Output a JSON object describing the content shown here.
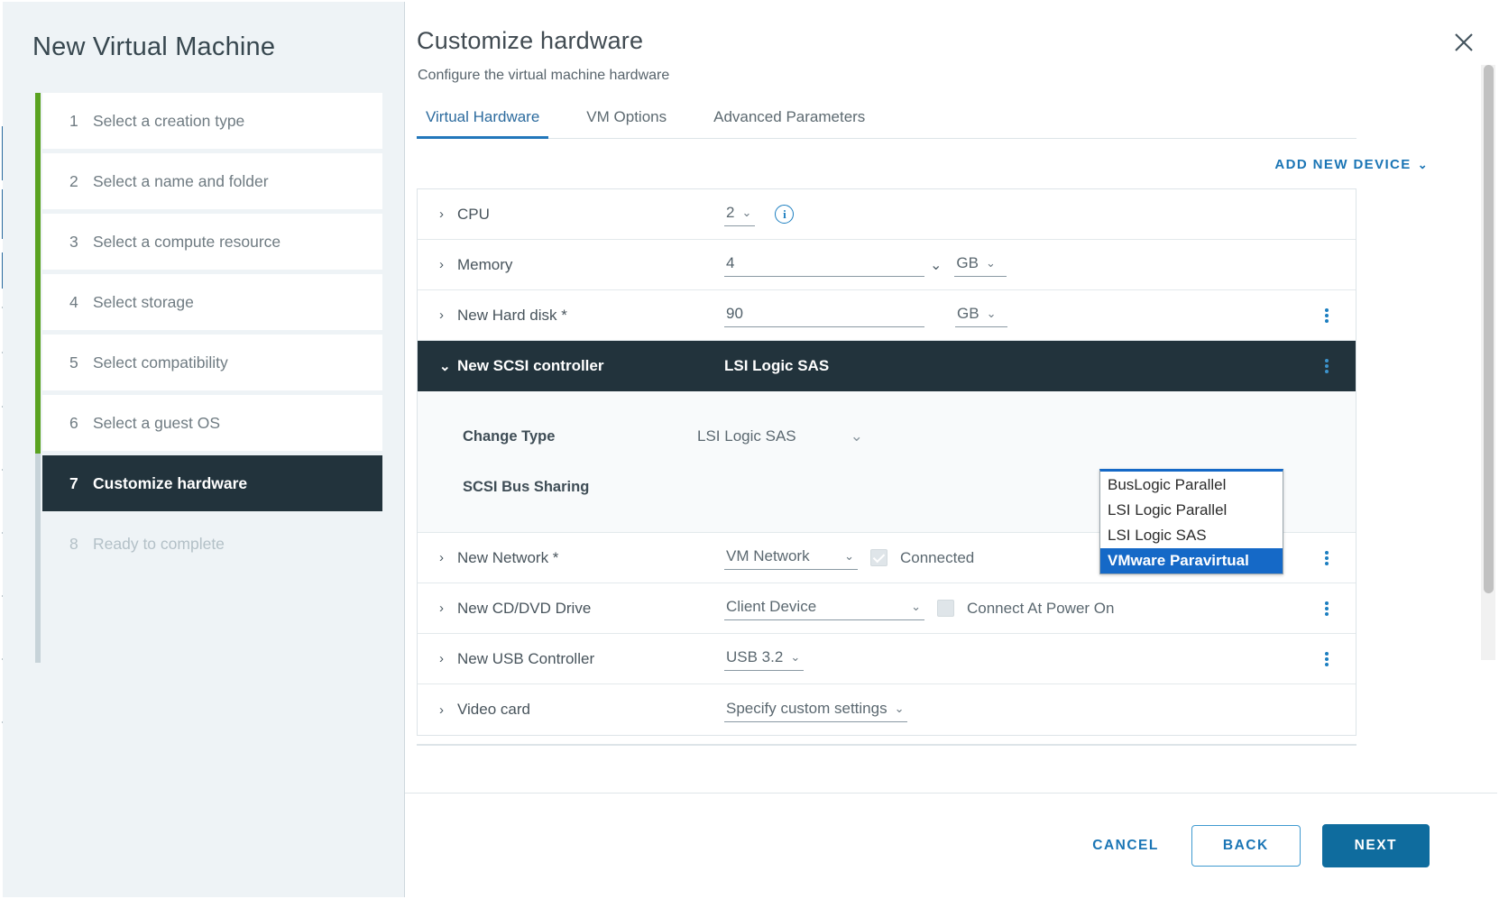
{
  "window": {
    "outer_border_color": "#9aa6ad"
  },
  "sidebar": {
    "title": "New Virtual Machine",
    "accent_done_color": "#5aa220",
    "accent_pending_color": "#c7d3d9",
    "current_bg": "#22333c",
    "steps": [
      {
        "num": "1",
        "label": "Select a creation type",
        "state": "done"
      },
      {
        "num": "2",
        "label": "Select a name and folder",
        "state": "done"
      },
      {
        "num": "3",
        "label": "Select a compute resource",
        "state": "done"
      },
      {
        "num": "4",
        "label": "Select storage",
        "state": "done"
      },
      {
        "num": "5",
        "label": "Select compatibility",
        "state": "done"
      },
      {
        "num": "6",
        "label": "Select a guest OS",
        "state": "done"
      },
      {
        "num": "7",
        "label": "Customize hardware",
        "state": "current"
      },
      {
        "num": "8",
        "label": "Ready to complete",
        "state": "disabled"
      }
    ]
  },
  "panel": {
    "title": "Customize hardware",
    "subtitle": "Configure the virtual machine hardware",
    "close_icon": "close-icon",
    "tabs": [
      {
        "label": "Virtual Hardware",
        "active": true
      },
      {
        "label": "VM Options",
        "active": false
      },
      {
        "label": "Advanced Parameters",
        "active": false
      }
    ],
    "active_tab_color": "#2277bb",
    "add_new_device": {
      "label": "ADD NEW DEVICE",
      "chevron": "⌄",
      "color": "#1a75b5"
    }
  },
  "hardware": {
    "rows": [
      {
        "label": "CPU",
        "caret": "›",
        "value": "2",
        "control": "select-number",
        "info_icon": "info-icon",
        "kebab": false
      },
      {
        "label": "Memory",
        "caret": "›",
        "value": "4",
        "control": "input-wide",
        "unit": "GB",
        "kebab": false
      },
      {
        "label": "New Hard disk *",
        "caret": "›",
        "value": "90",
        "control": "input-wide",
        "unit": "GB",
        "kebab": true
      }
    ],
    "scsi": {
      "label": "New SCSI controller",
      "caret": "⌄",
      "value": "LSI Logic SAS",
      "expanded": true,
      "kebab": true,
      "sub_rows": [
        {
          "label": "Change Type",
          "value": "LSI Logic SAS"
        },
        {
          "label": "SCSI Bus Sharing",
          "value": ""
        }
      ]
    },
    "dropdown": {
      "open": true,
      "accent_color": "#1569c7",
      "options": [
        {
          "label": "BusLogic Parallel",
          "selected": false
        },
        {
          "label": "LSI Logic Parallel",
          "selected": false
        },
        {
          "label": "LSI Logic SAS",
          "selected": false
        },
        {
          "label": "VMware Paravirtual",
          "selected": true
        }
      ]
    },
    "rows_after": [
      {
        "label": "New Network *",
        "caret": "›",
        "value": "VM Network",
        "control": "select-plain-underline",
        "checkbox": {
          "label": "Connected",
          "checked": true
        },
        "kebab": true
      },
      {
        "label": "New CD/DVD Drive",
        "caret": "›",
        "value": "Client Device",
        "control": "select-wide",
        "checkbox": {
          "label": "Connect At Power On",
          "checked": false
        },
        "kebab": true
      },
      {
        "label": "New USB Controller",
        "caret": "›",
        "value": "USB 3.2",
        "control": "select-plain-underline",
        "kebab": true
      },
      {
        "label": "Video card",
        "caret": "›",
        "value": "Specify custom settings",
        "control": "select-plain-underline",
        "kebab": false
      }
    ]
  },
  "footer": {
    "cancel": "CANCEL",
    "back": "BACK",
    "next": "NEXT",
    "primary_color": "#0f6c9e"
  },
  "scrollbar": {
    "name": "vertical-scrollbar",
    "track_color": "#f1f1f1",
    "thumb_color": "#c1c1c1"
  }
}
